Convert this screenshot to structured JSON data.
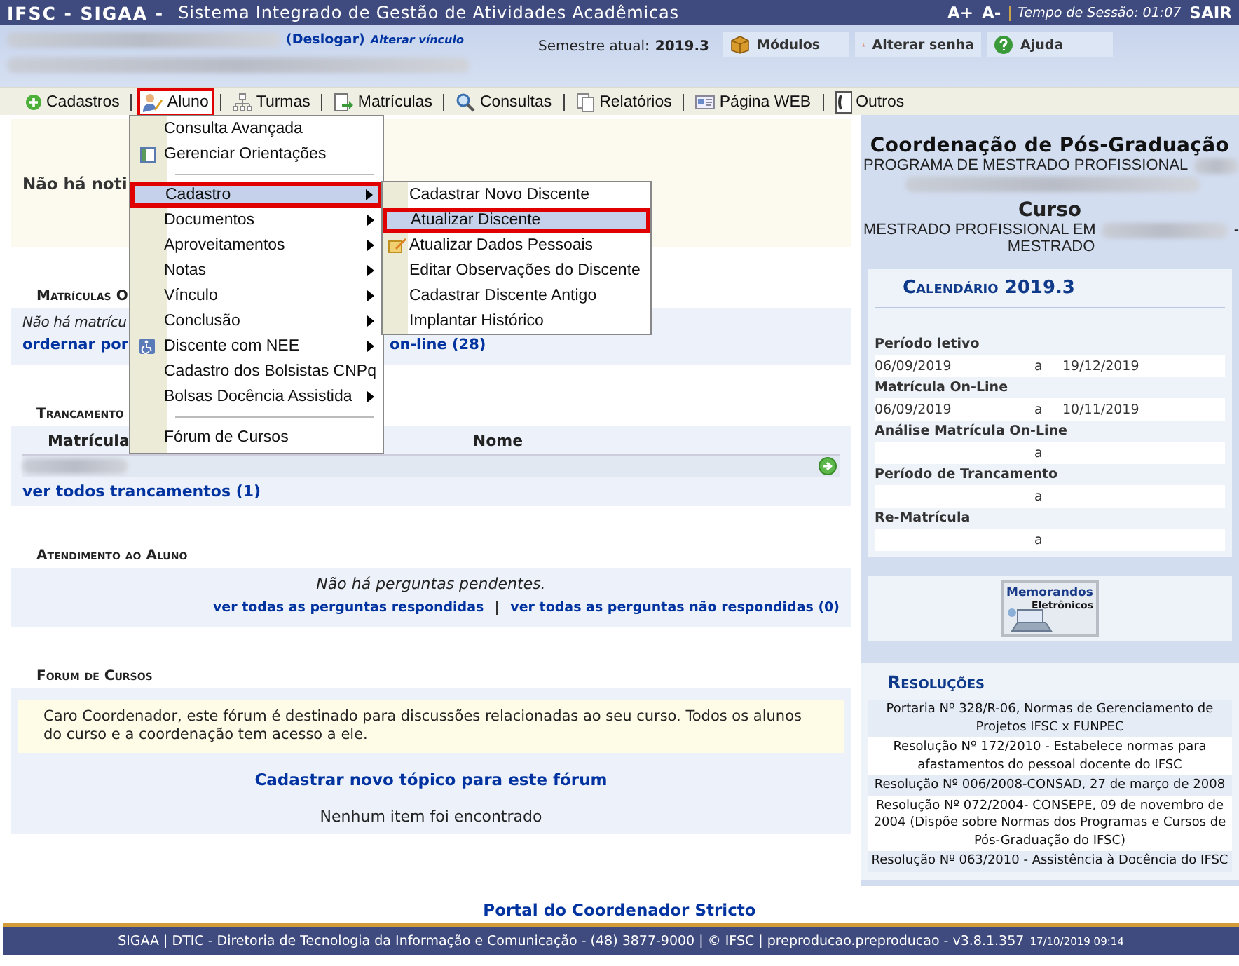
{
  "header": {
    "title": "IFSC - SIGAA -",
    "subtitle": "Sistema Integrado de Gestão de Atividades Acadêmicas",
    "font_up": "A+",
    "font_down": "A-",
    "session": "Tempo de Sessão: 01:07",
    "logout": "SAIR"
  },
  "user_bar": {
    "logoff": "(Deslogar)",
    "change_link": "Alterar vínculo",
    "semester_label": "Semestre atual:",
    "semester": "2019.3",
    "buttons": [
      {
        "label": "Módulos"
      },
      {
        "label": "Alterar senha"
      },
      {
        "label": "Ajuda"
      }
    ]
  },
  "menu": [
    {
      "label": "Cadastros",
      "selected": false
    },
    {
      "label": "Aluno",
      "selected": true
    },
    {
      "label": "Turmas",
      "selected": false
    },
    {
      "label": "Matrículas",
      "selected": false
    },
    {
      "label": "Consultas",
      "selected": false
    },
    {
      "label": "Relatórios",
      "selected": false
    },
    {
      "label": "Página WEB",
      "selected": false
    },
    {
      "label": "Outros",
      "selected": false
    }
  ],
  "dropdown": [
    {
      "kind": "item",
      "label": "Consulta Avançada",
      "submenu": false,
      "selected": false
    },
    {
      "kind": "item",
      "label": "Gerenciar Orientações",
      "submenu": false,
      "selected": false
    },
    {
      "kind": "separator"
    },
    {
      "kind": "item",
      "label": "Cadastro",
      "submenu": true,
      "selected": true
    },
    {
      "kind": "item",
      "label": "Documentos",
      "submenu": true,
      "selected": false
    },
    {
      "kind": "item",
      "label": "Aproveitamentos",
      "submenu": true,
      "selected": false
    },
    {
      "kind": "item",
      "label": "Notas",
      "submenu": true,
      "selected": false
    },
    {
      "kind": "item",
      "label": "Vínculo",
      "submenu": true,
      "selected": false
    },
    {
      "kind": "item",
      "label": "Conclusão",
      "submenu": true,
      "selected": false
    },
    {
      "kind": "item",
      "label": "Discente com NEE",
      "submenu": true,
      "selected": false
    },
    {
      "kind": "item",
      "label": "Cadastro dos Bolsistas CNPq",
      "submenu": false,
      "selected": false
    },
    {
      "kind": "item",
      "label": "Bolsas Docência Assistida",
      "submenu": true,
      "selected": false
    },
    {
      "kind": "separator"
    },
    {
      "kind": "item",
      "label": "Fórum de Cursos",
      "submenu": false,
      "selected": false
    }
  ],
  "submenu": [
    {
      "label": "Cadastrar Novo Discente",
      "selected": false
    },
    {
      "label": "Atualizar Discente",
      "selected": true
    },
    {
      "label": "Atualizar Dados Pessoais",
      "selected": false
    },
    {
      "label": "Editar Observações do Discente",
      "selected": false
    },
    {
      "label": "Cadastrar Discente Antigo",
      "selected": false
    },
    {
      "label": "Implantar Histórico",
      "selected": false
    }
  ],
  "notice": "Não há noti",
  "matriculas": {
    "title": "Matrículas O",
    "message": "Não há matrícu",
    "link_left": "ordernar por",
    "link_right": "on-line (28)"
  },
  "trancamentos": {
    "title": "Trancamento",
    "columns": [
      "Matrícula",
      "Nome"
    ],
    "link": "ver todos trancamentos (1)"
  },
  "atendimento": {
    "title": "Atendimento ao Aluno",
    "message": "Não há perguntas pendentes.",
    "links": [
      "ver todas as perguntas respondidas",
      "ver todas as perguntas não respondidas (0)"
    ]
  },
  "forum": {
    "title": "Forum de Cursos",
    "info": "Caro Coordenador, este fórum é destinado para discussões relacionadas ao seu curso. Todos os alunos do curso e a coordenação tem acesso a ele.",
    "link": "Cadastrar novo tópico para este fórum",
    "empty": "Nenhum item foi encontrado"
  },
  "sidebar": {
    "unit_title": "Coordenação de Pós-Graduação",
    "program": "PROGRAMA DE MESTRADO PROFISSIONAL",
    "course_title": "Curso",
    "course": "MESTRADO PROFISSIONAL EM",
    "course_dash": "-",
    "course_level": "MESTRADO",
    "calendar": {
      "title": "Calendário 2019.3",
      "periods": [
        {
          "label": "Período letivo",
          "start": "06/09/2019",
          "sep": "a",
          "end": "19/12/2019"
        },
        {
          "label": "Matrícula On-Line",
          "start": "06/09/2019",
          "sep": "a",
          "end": "10/11/2019"
        },
        {
          "label": "Análise Matrícula On-Line",
          "sep": "a"
        },
        {
          "label": "Período de Trancamento",
          "sep": "a"
        },
        {
          "label": "Re-Matrícula",
          "sep": "a"
        }
      ]
    },
    "memo_button": [
      "Memorandos",
      "Eletrônicos"
    ],
    "resolutions_title": "Resoluções",
    "resolutions": [
      "Portaria Nº 328/R-06, Normas de Gerenciamento de Projetos IFSC x FUNPEC",
      "Resolução Nº 172/2010 - Estabelece normas para afastamentos do pessoal docente do IFSC",
      "Resolução Nº 006/2008-CONSAD, 27 de março de 2008",
      "Resolução Nº 072/2004- CONSEPE, 09 de novembro de 2004 (Dispõe sobre Normas dos Programas e Cursos de Pós-Graduação do IFSC)",
      "Resolução Nº 063/2010 - Assistência à Docência do IFSC"
    ]
  },
  "portal_link": "Portal do Coordenador Stricto",
  "footer": {
    "text": "SIGAA | DTIC - Diretoria de Tecnologia da Informação e Comunicação - (48) 3877-9000 | © IFSC | preproducao.preproducao - v3.8.1.357",
    "timestamp": "17/10/2019 09:14"
  }
}
